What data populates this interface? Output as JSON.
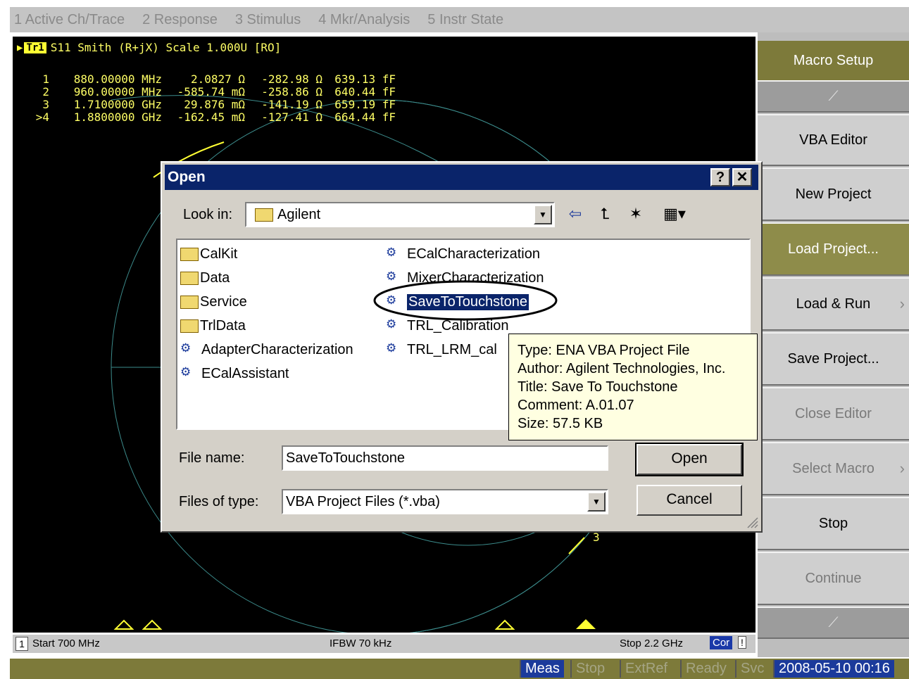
{
  "menubar": {
    "items": [
      "1 Active Ch/Trace",
      "2 Response",
      "3 Stimulus",
      "4 Mkr/Analysis",
      "5 Instr State"
    ]
  },
  "trace": {
    "badge": "Tr1",
    "header": "S11 Smith (R+jX) Scale 1.000U [RO]",
    "color": "#ffff66",
    "markers": [
      {
        "idx": "1",
        "freq": "880.00000 MHz",
        "res": "2.0827 Ω",
        "rea": "-282.98 Ω",
        "cap": "639.13 fF"
      },
      {
        "idx": "2",
        "freq": "960.00000 MHz",
        "res": "-585.74 mΩ",
        "rea": "-258.86 Ω",
        "cap": "640.44 fF"
      },
      {
        "idx": "3",
        "freq": "1.7100000 GHz",
        "res": "29.876 mΩ",
        "rea": "-141.19 Ω",
        "cap": "659.19 fF"
      },
      {
        "idx": ">4",
        "freq": "1.8800000 GHz",
        "res": "-162.45 mΩ",
        "rea": "-127.41 Ω",
        "cap": "664.44 fF"
      }
    ],
    "marker3_label": "3"
  },
  "screen_status": {
    "channel": "1",
    "start": "Start 700 MHz",
    "ifbw": "IFBW 70 kHz",
    "stop": "Stop 2.2 GHz",
    "cor": "Cor",
    "flag": "!"
  },
  "instr_status": {
    "meas": "Meas",
    "stop": "Stop",
    "extref": "ExtRef",
    "ready": "Ready",
    "svc": "Svc",
    "datetime": "2008-05-10 00:16"
  },
  "softkeys": {
    "title": "Macro Setup",
    "items": [
      {
        "label": "VBA Editor",
        "state": "normal"
      },
      {
        "label": "New Project",
        "state": "normal"
      },
      {
        "label": "Load Project...",
        "state": "active"
      },
      {
        "label": "Load & Run",
        "state": "normal"
      },
      {
        "label": "Save Project...",
        "state": "normal"
      },
      {
        "label": "Close Editor",
        "state": "disabled"
      },
      {
        "label": "Select Macro",
        "state": "disabled"
      },
      {
        "label": "Stop",
        "state": "normal"
      },
      {
        "label": "Continue",
        "state": "disabled"
      }
    ]
  },
  "dialog": {
    "title": "Open",
    "help_btn": "?",
    "close_btn": "✕",
    "lookin_label": "Look in:",
    "lookin_value": "Agilent",
    "files": [
      {
        "name": "CalKit",
        "type": "folder"
      },
      {
        "name": "Data",
        "type": "folder"
      },
      {
        "name": "Service",
        "type": "folder"
      },
      {
        "name": "TrlData",
        "type": "folder"
      },
      {
        "name": "AdapterCharacterization",
        "type": "project"
      },
      {
        "name": "ECalAssistant",
        "type": "project"
      },
      {
        "name": "ECalCharacterization",
        "type": "project"
      },
      {
        "name": "MixerCharacterization",
        "type": "project"
      },
      {
        "name": "SaveToTouchstone",
        "type": "project",
        "selected": true
      },
      {
        "name": "TRL_Calibration",
        "type": "project"
      },
      {
        "name": "TRL_LRM_cal",
        "type": "project"
      }
    ],
    "tooltip": {
      "type": "Type: ENA VBA Project File",
      "author": "Author: Agilent Technologies, Inc.",
      "title": "Title: Save To Touchstone",
      "comment": "Comment: A.01.07",
      "size": "Size: 57.5 KB"
    },
    "filename_label": "File name:",
    "filename_value": "SaveToTouchstone",
    "filetype_label": "Files of type:",
    "filetype_value": "VBA Project Files (*.vba)",
    "open_btn": "Open",
    "cancel_btn": "Cancel"
  }
}
